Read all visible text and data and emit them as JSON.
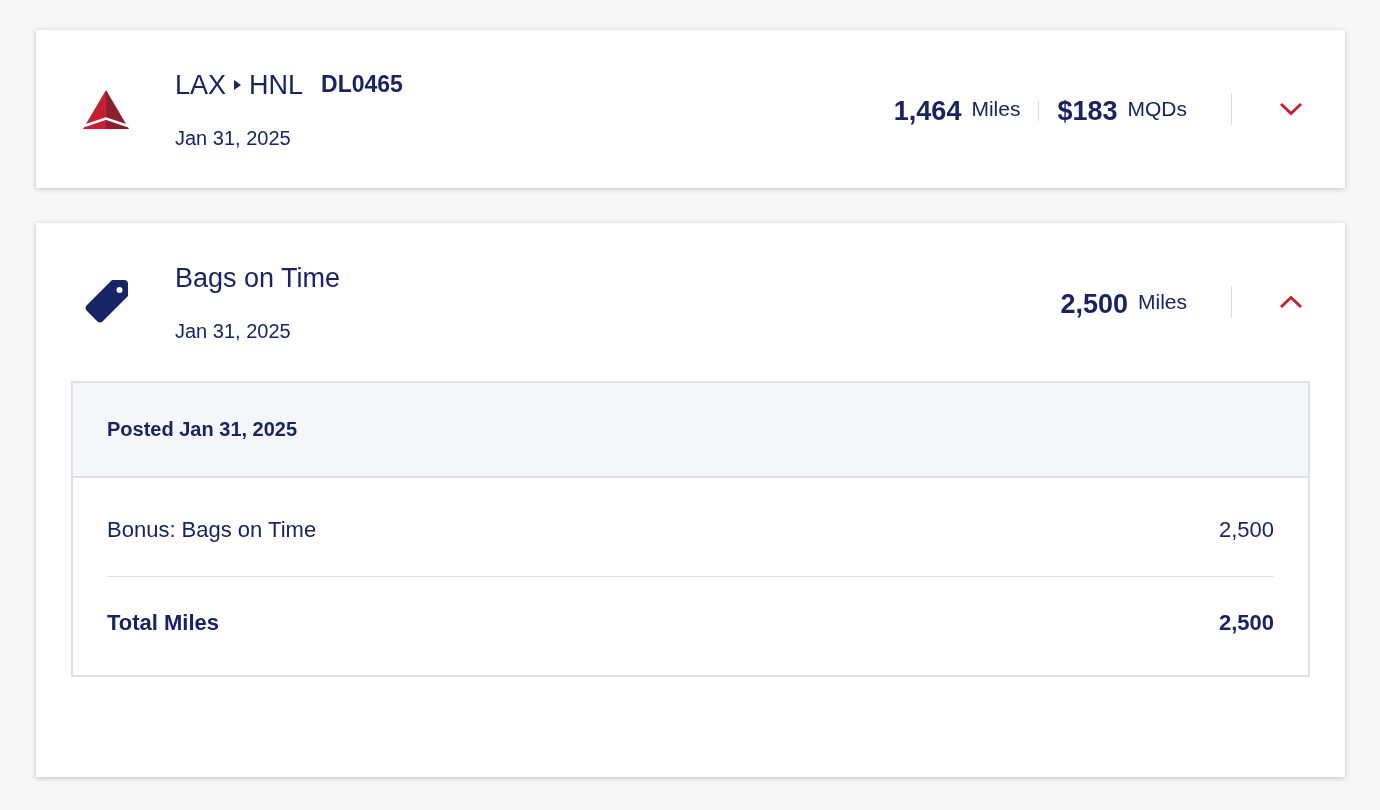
{
  "activities": [
    {
      "kind": "flight",
      "origin": "LAX",
      "destination": "HNL",
      "flight_number": "DL0465",
      "date": "Jan 31, 2025",
      "earnings": [
        {
          "amount": "1,464",
          "unit": "Miles"
        },
        {
          "amount": "$183",
          "unit": "MQDs"
        }
      ],
      "expanded": false
    },
    {
      "kind": "bonus",
      "title": "Bags on Time",
      "date": "Jan 31, 2025",
      "earnings": [
        {
          "amount": "2,500",
          "unit": "Miles"
        }
      ],
      "expanded": true,
      "details": {
        "posted": "Posted Jan 31, 2025",
        "line_items": [
          {
            "label": "Bonus: Bags on Time",
            "value": "2,500"
          }
        ],
        "total": {
          "label": "Total Miles",
          "value": "2,500"
        }
      }
    }
  ]
}
